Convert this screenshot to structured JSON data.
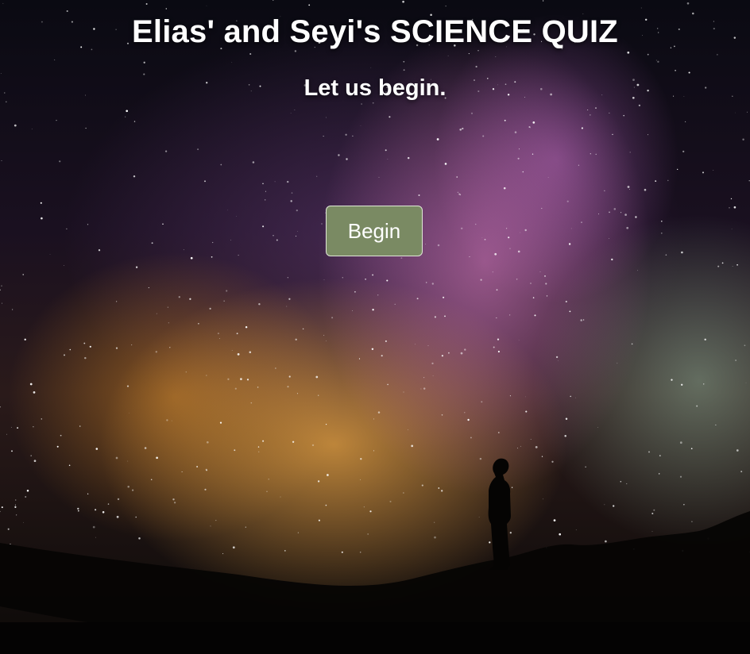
{
  "header": {
    "title": "Elias' and Seyi's SCIENCE QUIZ",
    "subtitle": "Let us begin."
  },
  "actions": {
    "begin_label": "Begin"
  },
  "colors": {
    "button_background": "#7a8a63",
    "text": "#ffffff"
  }
}
